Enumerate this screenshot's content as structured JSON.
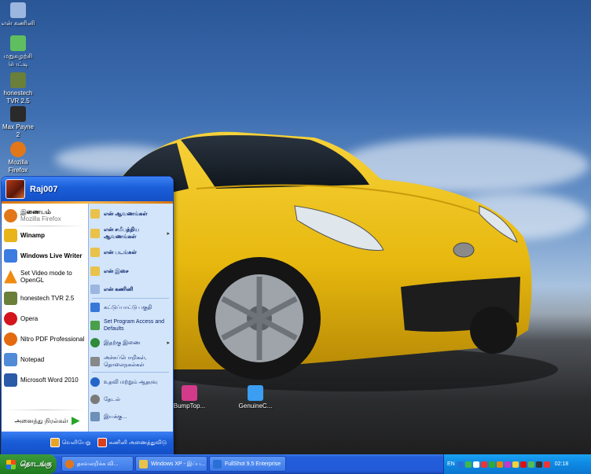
{
  "desktop": {
    "icons": [
      {
        "label": "என் கணினி",
        "icon": "my-computer-icon",
        "color": "#9bb6df"
      },
      {
        "label": "மறுசுழற்சி பெட்டி",
        "icon": "recycle-bin-icon",
        "color": "#5fbf5f"
      },
      {
        "label": "honestech TVR 2.5",
        "icon": "tvr-icon",
        "color": "#6a7f3a"
      },
      {
        "label": "Max Payne 2",
        "icon": "max-payne-icon",
        "color": "#2a2a2a"
      },
      {
        "label": "Mozilla Firefox",
        "icon": "firefox-icon",
        "color": "#e2771a"
      }
    ],
    "bottom_icons": [
      {
        "label": "BumpTop...",
        "icon": "bumptop-icon",
        "color": "#d33a8a"
      },
      {
        "label": "GenuineC...",
        "icon": "genuine-check-icon",
        "color": "#3b9ef2"
      }
    ]
  },
  "start_menu": {
    "username": "Raj007",
    "pinned": [
      {
        "title": "இணையம்",
        "subtitle": "Mozilla Firefox",
        "icon": "firefox-icon",
        "color": "#e2771a"
      }
    ],
    "recent": [
      {
        "label": "Winamp",
        "bold": true,
        "icon": "winamp-icon",
        "color": "#e9b31a"
      },
      {
        "label": "Windows Live Writer",
        "bold": true,
        "icon": "live-writer-icon",
        "color": "#3c7be0"
      },
      {
        "label": "Set Video mode to OpenGL",
        "icon": "vlc-icon",
        "color": "#f08a12"
      },
      {
        "label": "honestech TVR 2.5",
        "icon": "tvr-icon",
        "color": "#6a7f3a"
      },
      {
        "label": "Opera",
        "icon": "opera-icon",
        "color": "#d3141c"
      },
      {
        "label": "Nitro PDF Professional",
        "icon": "nitro-pdf-icon",
        "color": "#e36a10"
      },
      {
        "label": "Notepad",
        "icon": "notepad-icon",
        "color": "#4f8bd6"
      },
      {
        "label": "Microsoft Word 2010",
        "icon": "word-icon",
        "color": "#2a5aa8"
      }
    ],
    "all_programs": "அனைத்து நிரல்கள்",
    "right_items": [
      {
        "label": "என் ஆவணங்கள்",
        "icon": "my-documents-icon",
        "color": "#e9c24a",
        "arrow": false
      },
      {
        "label": "என் சமீபத்திய ஆவணங்கள்",
        "icon": "recent-documents-icon",
        "color": "#e9c24a",
        "arrow": true
      },
      {
        "label": "என் படங்கள்",
        "icon": "my-pictures-icon",
        "color": "#e9c24a",
        "arrow": false
      },
      {
        "label": "என் இசை",
        "icon": "my-music-icon",
        "color": "#e9c24a",
        "arrow": false
      },
      {
        "label": "என் கணினி",
        "icon": "my-computer-icon",
        "color": "#9bb6df",
        "arrow": false
      },
      {
        "label": "கட்டுப்பாட்டு பகுதி",
        "icon": "control-panel-icon",
        "color": "#3a78d8",
        "arrow": false
      },
      {
        "label": "Set Program Access and Defaults",
        "icon": "program-access-icon",
        "color": "#4aa04a",
        "arrow": false
      },
      {
        "label": "இதற்கு இணை",
        "icon": "connect-to-icon",
        "color": "#2f8a3a",
        "arrow": true
      },
      {
        "label": "அச்சுப்பொறிகள், தொலைநகல்கள்",
        "icon": "printers-icon",
        "color": "#888888",
        "arrow": false
      },
      {
        "label": "உதவி மற்றும் ஆதரவு",
        "icon": "help-icon",
        "color": "#2465c9",
        "arrow": false
      },
      {
        "label": "தேடல்",
        "icon": "search-icon",
        "color": "#7a7a7a",
        "arrow": false
      },
      {
        "label": "இயக்கு...",
        "icon": "run-icon",
        "color": "#6d8fb8",
        "arrow": false
      }
    ],
    "footer": {
      "logoff": "வெளியேறு",
      "shutdown": "கணினி அணைத்துவிடு"
    }
  },
  "taskbar": {
    "start_label": "தொடங்கு",
    "buttons": [
      {
        "label": "தகவலறிக்க வி...",
        "icon": "firefox-icon",
        "color": "#e2771a"
      },
      {
        "label": "Windows XP - இப்ப...",
        "icon": "explorer-icon",
        "color": "#e9c24a"
      },
      {
        "label": "FullShot 9.5 Enterprise",
        "icon": "fullshot-icon",
        "color": "#2a6fd6"
      }
    ],
    "tray": {
      "language": "EN",
      "clock": "02:18",
      "icon_colors": [
        "#2a6fd6",
        "#3fb84a",
        "#ffffff",
        "#e33",
        "#3a3",
        "#e80",
        "#c3c",
        "#f6d23a",
        "#d11",
        "#5b5",
        "#333",
        "#e33"
      ]
    }
  }
}
